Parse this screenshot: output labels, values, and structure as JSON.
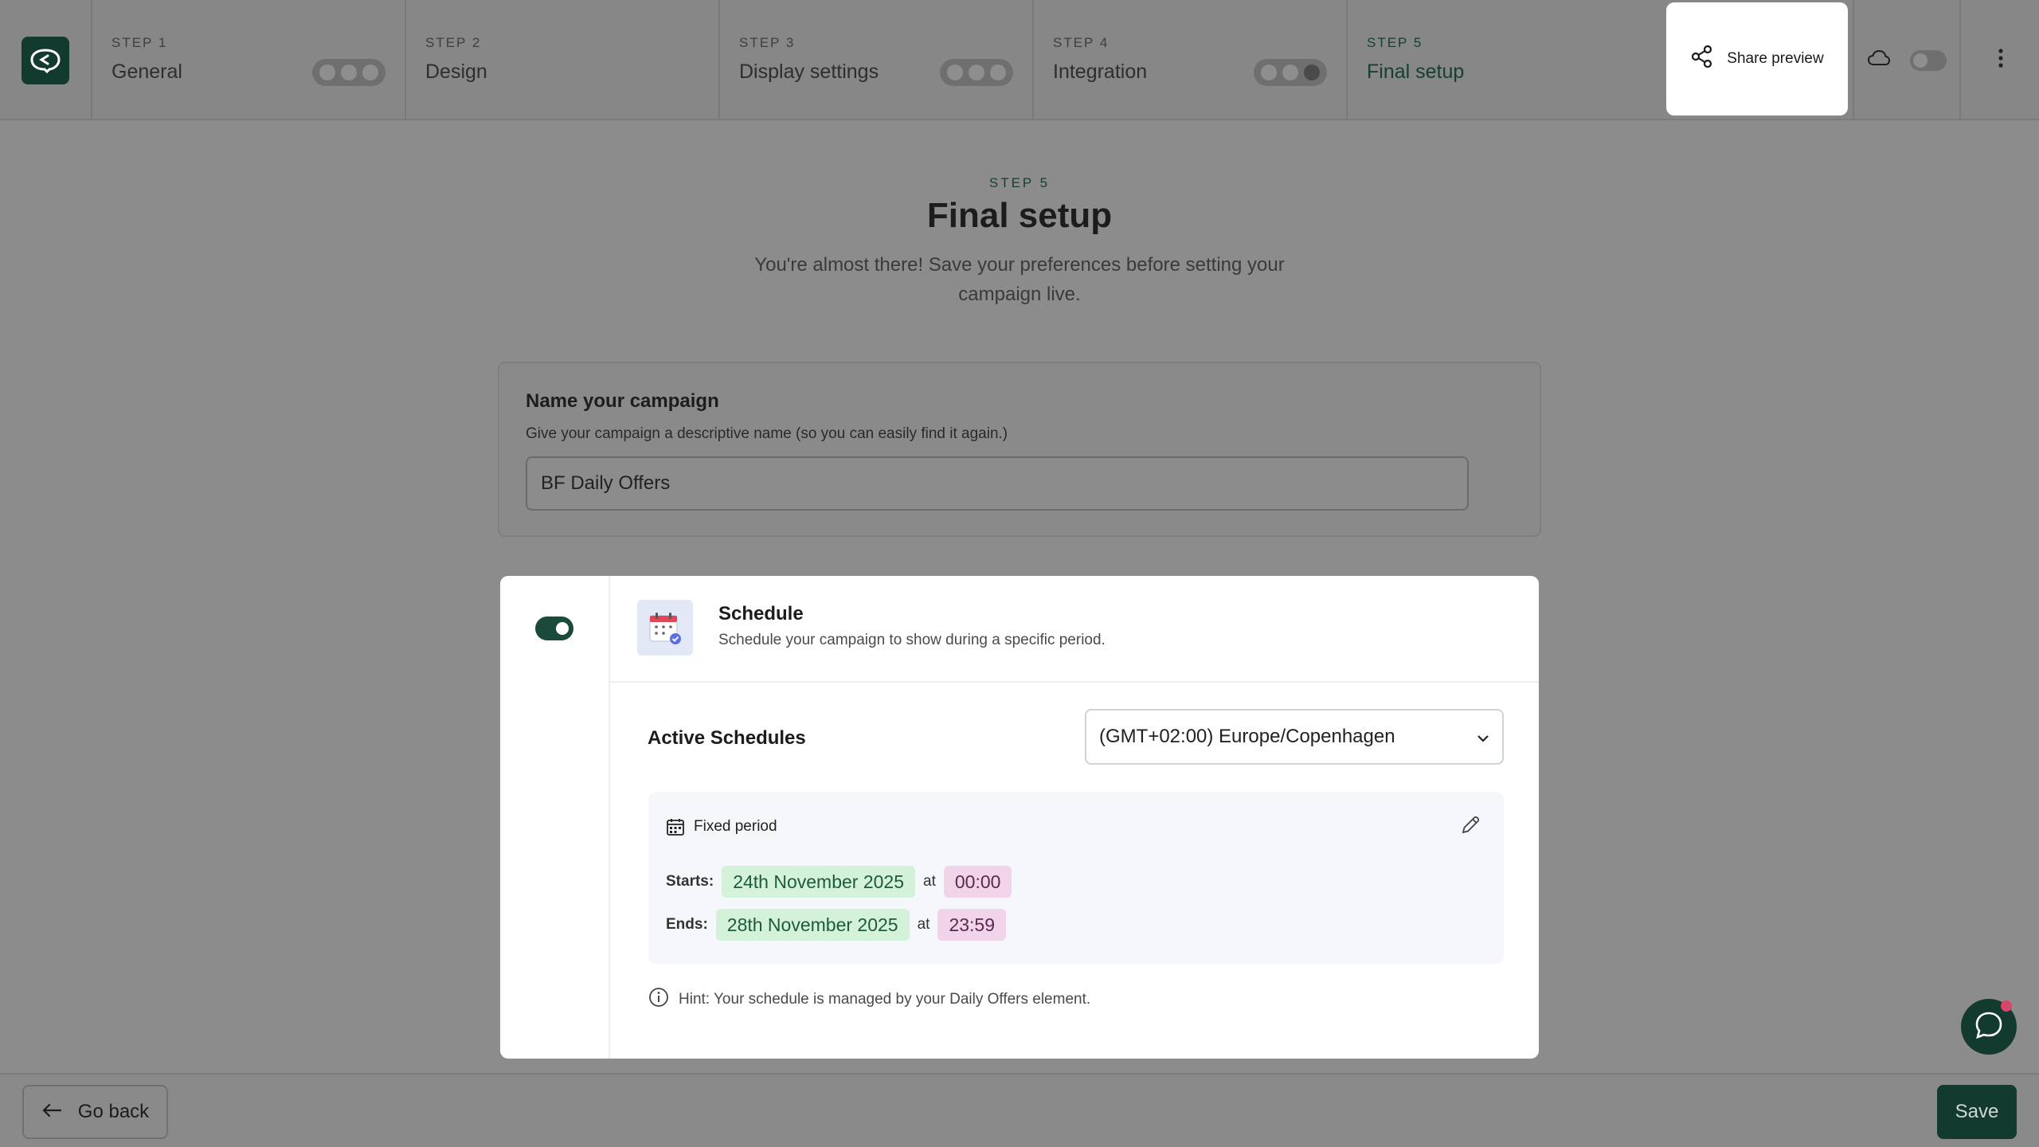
{
  "nav": {
    "steps": [
      {
        "num": "STEP 1",
        "title": "General"
      },
      {
        "num": "STEP 2",
        "title": "Design"
      },
      {
        "num": "STEP 3",
        "title": "Display settings"
      },
      {
        "num": "STEP 4",
        "title": "Integration"
      },
      {
        "num": "STEP 5",
        "title": "Final setup"
      }
    ],
    "share_label": "Share preview",
    "icons": {
      "logo": "chat-bubble-logo-icon",
      "share": "share-icon",
      "cloud": "cloud-icon",
      "more": "more-vertical-icon"
    }
  },
  "header": {
    "step": "STEP 5",
    "title": "Final setup",
    "subtitle": "You're almost there! Save your preferences before setting your campaign live."
  },
  "name_card": {
    "title": "Name your campaign",
    "description": "Give your campaign a descriptive name (so you can easily find it again.)",
    "value": "BF Daily Offers"
  },
  "schedule": {
    "enabled": true,
    "title": "Schedule",
    "description": "Schedule your campaign to show during a specific period.",
    "active_label": "Active Schedules",
    "timezone": "(GMT+02:00) Europe/Copenhagen",
    "period_title": "Fixed period",
    "starts_label": "Starts:",
    "start_date": "24th November 2025",
    "start_time": "00:00",
    "ends_label": "Ends:",
    "end_date": "28th November 2025",
    "end_time": "23:59",
    "at_label": "at",
    "hint": "Hint: Your schedule is managed by your Daily Offers element."
  },
  "footer": {
    "back_label": "Go back",
    "save_label": "Save"
  },
  "colors": {
    "brand": "#133a2f",
    "date_chip": "#d3f2d8",
    "time_chip": "#f1d3ea"
  }
}
